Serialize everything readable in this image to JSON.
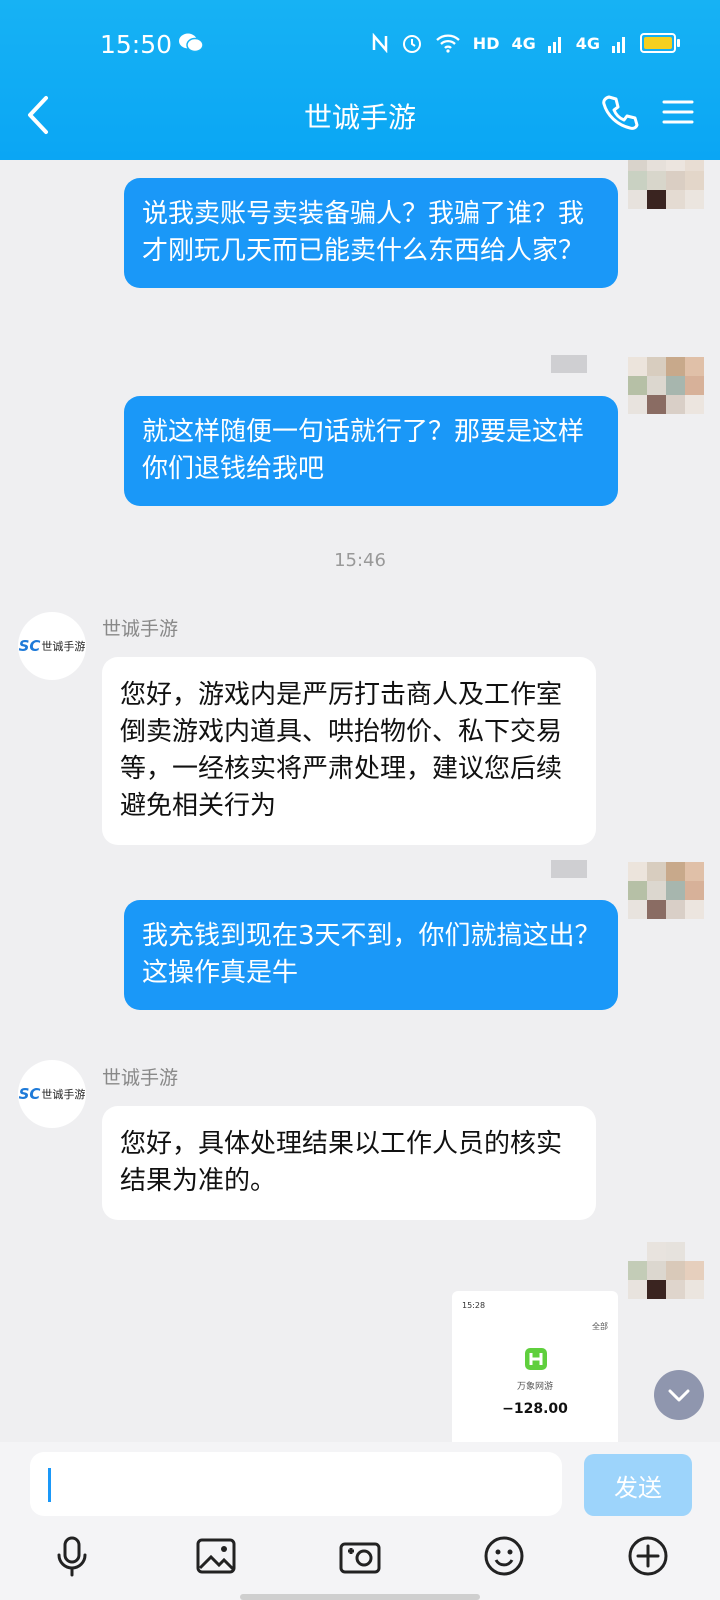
{
  "status_bar": {
    "time": "15:50",
    "signal_1": "4G",
    "signal_2": "4G",
    "wifi_label": "HD",
    "icons": [
      "wechat-icon",
      "nfc-icon",
      "alarm-icon",
      "wifi-icon",
      "signal-icon",
      "battery-icon"
    ]
  },
  "header": {
    "title": "世诚手游",
    "icons": [
      "back-arrow-icon",
      "phone-icon",
      "menu-icon"
    ]
  },
  "messages": {
    "out_1": "说我卖账号卖装备骗人？我骗了谁？我才刚玩几天而已能卖什么东西给人家？",
    "out_2": "就这样随便一句话就行了？那要是这样你们退钱给我吧",
    "time_1": "15:46",
    "sender_1": "世诚手游",
    "in_1": "您好，游戏内是严厉打击商人及工作室倒卖游戏内道具、哄抬物价、私下交易等，一经核实将严肃处理，建议您后续避免相关行为",
    "out_3": "我充钱到现在3天不到，你们就搞这出？这操作真是牛",
    "sender_2": "世诚手游",
    "in_2": "您好，具体处理结果以工作人员的核实结果为准的。"
  },
  "avatar_logo": {
    "mark": "SC",
    "text": "世诚手游"
  },
  "screenshot_card": {
    "time": "15:28",
    "tag": "全部",
    "app_name": "万象网游",
    "amount": "−128.00"
  },
  "input": {
    "value": "",
    "send_label": "发送"
  },
  "toolbar": {
    "icons": [
      "microphone-icon",
      "image-icon",
      "camera-icon",
      "emoji-icon",
      "plus-icon"
    ]
  },
  "colors": {
    "header": "#0aa6f4",
    "bubble_out": "#1a98f8",
    "send_disabled": "#9dd4fb"
  }
}
